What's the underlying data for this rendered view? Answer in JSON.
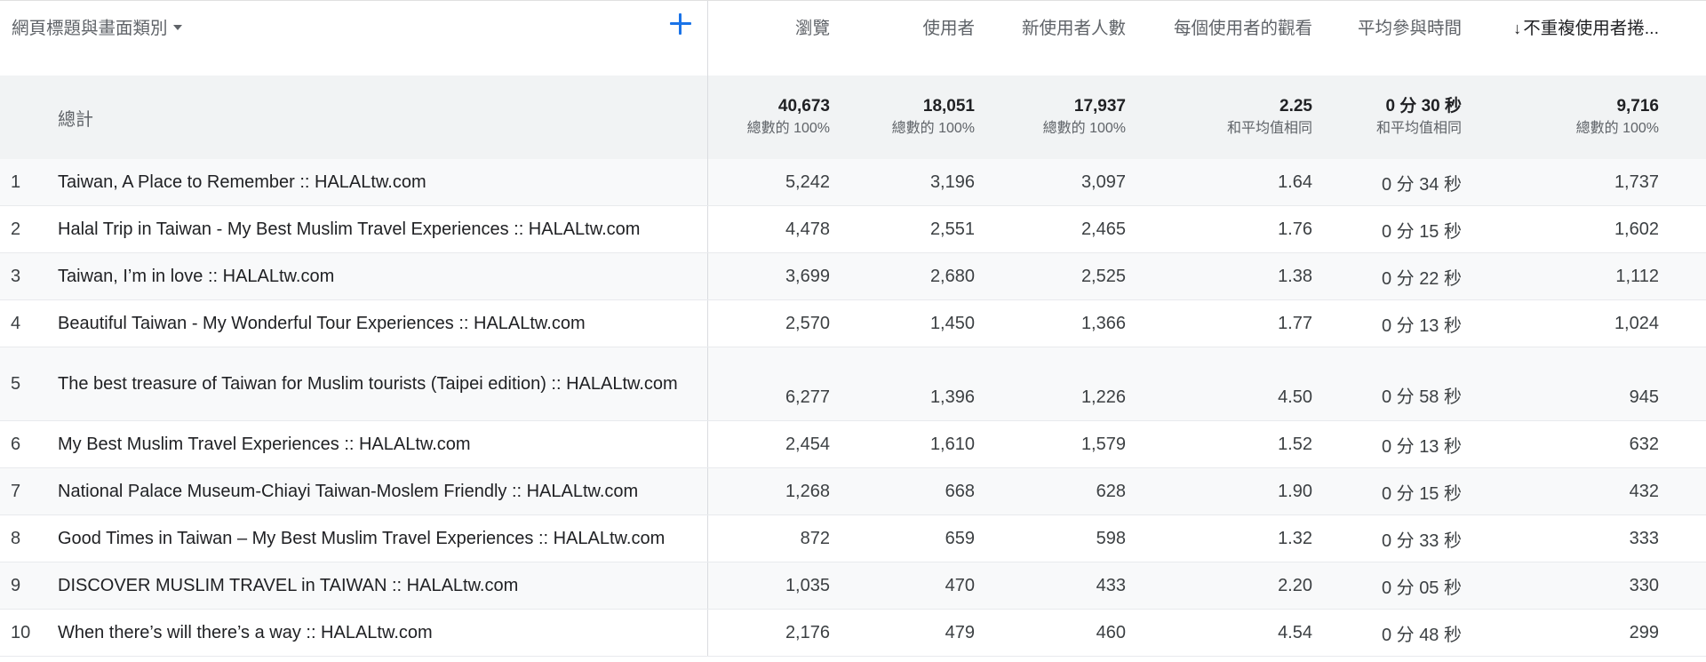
{
  "header": {
    "dimension_label": "網頁標題與畫面類別",
    "columns": [
      "瀏覽",
      "使用者",
      "新使用者人數",
      "每個使用者的觀看",
      "平均參與時間",
      "不重複使用者捲..."
    ]
  },
  "total": {
    "label": "總計",
    "values": [
      "40,673",
      "18,051",
      "17,937",
      "2.25",
      "0 分 30 秒",
      "9,716"
    ],
    "subs": [
      "總數的 100%",
      "總數的 100%",
      "總數的 100%",
      "和平均值相同",
      "和平均值相同",
      "總數的 100%"
    ]
  },
  "rows": [
    {
      "idx": "1",
      "title": "Taiwan, A Place to Remember :: HALALtw.com",
      "views": "5,242",
      "users": "3,196",
      "new_users": "3,097",
      "views_per_user": "1.64",
      "avg_time": "0 分 34 秒",
      "scrolled": "1,737"
    },
    {
      "idx": "2",
      "title": "Halal Trip in Taiwan - My Best Muslim Travel Experiences :: HALALtw.com",
      "views": "4,478",
      "users": "2,551",
      "new_users": "2,465",
      "views_per_user": "1.76",
      "avg_time": "0 分 15 秒",
      "scrolled": "1,602"
    },
    {
      "idx": "3",
      "title": "Taiwan, I’m in love :: HALALtw.com",
      "views": "3,699",
      "users": "2,680",
      "new_users": "2,525",
      "views_per_user": "1.38",
      "avg_time": "0 分 22 秒",
      "scrolled": "1,112"
    },
    {
      "idx": "4",
      "title": "Beautiful Taiwan - My Wonderful Tour Experiences :: HALALtw.com",
      "views": "2,570",
      "users": "1,450",
      "new_users": "1,366",
      "views_per_user": "1.77",
      "avg_time": "0 分 13 秒",
      "scrolled": "1,024"
    },
    {
      "idx": "5",
      "title": "The best treasure of Taiwan for Muslim tourists (Taipei edition) :: HALALtw.com",
      "views": "6,277",
      "users": "1,396",
      "new_users": "1,226",
      "views_per_user": "4.50",
      "avg_time": "0 分 58 秒",
      "scrolled": "945"
    },
    {
      "idx": "6",
      "title": "My Best Muslim Travel Experiences :: HALALtw.com",
      "views": "2,454",
      "users": "1,610",
      "new_users": "1,579",
      "views_per_user": "1.52",
      "avg_time": "0 分 13 秒",
      "scrolled": "632"
    },
    {
      "idx": "7",
      "title": "National Palace Museum-Chiayi Taiwan-Moslem Friendly :: HALALtw.com",
      "views": "1,268",
      "users": "668",
      "new_users": "628",
      "views_per_user": "1.90",
      "avg_time": "0 分 15 秒",
      "scrolled": "432"
    },
    {
      "idx": "8",
      "title": "Good Times in Taiwan – My Best Muslim Travel Experiences :: HALALtw.com",
      "views": "872",
      "users": "659",
      "new_users": "598",
      "views_per_user": "1.32",
      "avg_time": "0 分 33 秒",
      "scrolled": "333"
    },
    {
      "idx": "9",
      "title": "DISCOVER MUSLIM TRAVEL in TAIWAN :: HALALtw.com",
      "views": "1,035",
      "users": "470",
      "new_users": "433",
      "views_per_user": "2.20",
      "avg_time": "0 分 05 秒",
      "scrolled": "330"
    },
    {
      "idx": "10",
      "title": "When there’s will there’s a way :: HALALtw.com",
      "views": "2,176",
      "users": "479",
      "new_users": "460",
      "views_per_user": "4.54",
      "avg_time": "0 分 48 秒",
      "scrolled": "299"
    }
  ]
}
